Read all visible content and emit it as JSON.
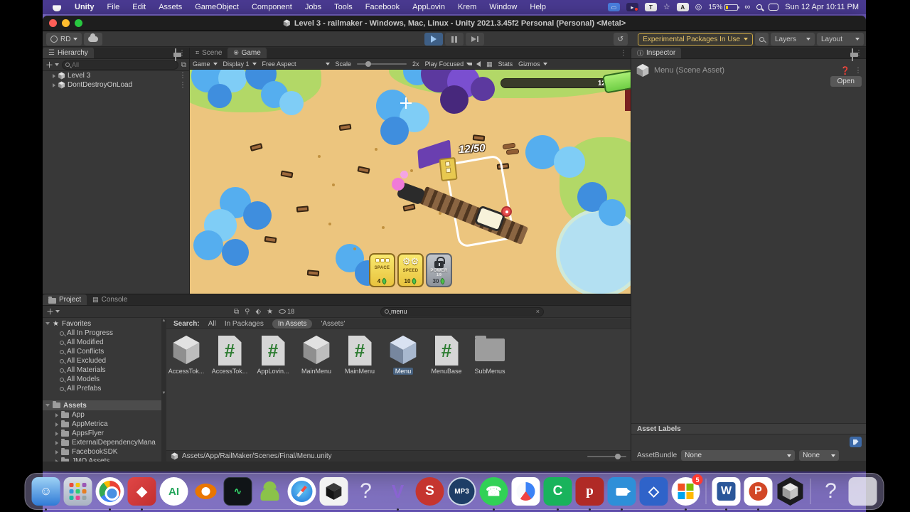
{
  "colors": {
    "accent_blue": "#4a7fe0",
    "experimental_gold": "#e3c168",
    "selection_blue": "#46607e",
    "play_active": "#3e5f86"
  },
  "menubar": {
    "items": [
      "Unity",
      "File",
      "Edit",
      "Assets",
      "GameObject",
      "Component",
      "Jobs",
      "Tools",
      "Facebook",
      "AppLovin",
      "Krem",
      "Window",
      "Help"
    ],
    "battery": "15%",
    "clock": "Sun 12 Apr 10:11 PM"
  },
  "window_title": "Level 3 - railmaker - Windows, Mac, Linux - Unity 2021.3.45f2 Personal (Personal) <Metal>",
  "toolbar": {
    "account": "RD",
    "experimental": "Experimental Packages In Use",
    "layers": "Layers",
    "layout": "Layout"
  },
  "hierarchy": {
    "tab": "Hierarchy",
    "search_placeholder": "All",
    "items": [
      "Level 3",
      "DontDestroyOnLoad"
    ]
  },
  "game": {
    "tab_scene": "Scene",
    "tab_game": "Game",
    "mode": "Game",
    "display": "Display 1",
    "aspect": "Free Aspect",
    "scale_label": "Scale",
    "scale_value": "2x",
    "focus": "Play Focused",
    "stats": "Stats",
    "gizmos": "Gizmos",
    "hud": {
      "progress_value": "12",
      "wood_counter": "12/50",
      "buttons": [
        {
          "label": "SPACE",
          "sub": "",
          "value": "4"
        },
        {
          "label": "SPEED",
          "sub": "",
          "value": "10"
        },
        {
          "label": "POWER",
          "sub": "1/9",
          "value": "30"
        }
      ]
    }
  },
  "inspector": {
    "tab": "Inspector",
    "title": "Menu (Scene Asset)",
    "open_button": "Open",
    "asset_labels_header": "Asset Labels",
    "assetbundle_label": "AssetBundle",
    "bundle_value": "None",
    "variant_value": "None"
  },
  "project": {
    "tab_project": "Project",
    "tab_console": "Console",
    "search_value": "menu",
    "eye_count": "18",
    "filter_label": "Search:",
    "filters": [
      "All",
      "In Packages",
      "In Assets",
      "'Assets'"
    ],
    "favorites_header": "Favorites",
    "favorites": [
      "All In Progress",
      "All Modified",
      "All Conflicts",
      "All Excluded",
      "All Materials",
      "All Models",
      "All Prefabs"
    ],
    "assets_header": "Assets",
    "folders": [
      "App",
      "AppMetrica",
      "AppsFlyer",
      "ExternalDependencyMana",
      "FacebookSDK",
      "JMO Assets"
    ],
    "grid": [
      {
        "name": "AccessTok...",
        "type": "asset"
      },
      {
        "name": "AccessTok...",
        "type": "script"
      },
      {
        "name": "AppLovin...",
        "type": "script"
      },
      {
        "name": "MainMenu",
        "type": "asset"
      },
      {
        "name": "MainMenu",
        "type": "script"
      },
      {
        "name": "Menu",
        "type": "asset-selected"
      },
      {
        "name": "MenuBase",
        "type": "script"
      },
      {
        "name": "SubMenus",
        "type": "folder"
      }
    ],
    "footer_path": "Assets/App/RailMaker/Scenes/Final/Menu.unity"
  },
  "dock": {
    "items": [
      {
        "name": "finder",
        "glyph": "☺"
      },
      {
        "name": "launchpad",
        "glyph": ""
      },
      {
        "name": "chrome",
        "glyph": ""
      },
      {
        "name": "appcode",
        "glyph": "◆"
      },
      {
        "name": "android-studio",
        "glyph": "AI"
      },
      {
        "name": "blender",
        "glyph": ""
      },
      {
        "name": "activity-monitor",
        "glyph": "∿"
      },
      {
        "name": "android",
        "glyph": ""
      },
      {
        "name": "safari",
        "glyph": ""
      },
      {
        "name": "unity-hub",
        "glyph": ""
      },
      {
        "name": "placeholder-question",
        "glyph": "?"
      },
      {
        "name": "visual-studio",
        "glyph": "V"
      },
      {
        "name": "rider",
        "glyph": "S"
      },
      {
        "name": "mp3-player",
        "glyph": "MP3"
      },
      {
        "name": "whatsapp",
        "glyph": "☎"
      },
      {
        "name": "paint-app",
        "glyph": ""
      },
      {
        "name": "camtasia",
        "glyph": "C"
      },
      {
        "name": "pandora",
        "glyph": "p"
      },
      {
        "name": "screen-recorder",
        "glyph": ""
      },
      {
        "name": "diamond-app",
        "glyph": "◇"
      },
      {
        "name": "ms365",
        "glyph": "",
        "badge": "5"
      },
      {
        "name": "word",
        "glyph": "W"
      },
      {
        "name": "powerpoint",
        "glyph": "P"
      },
      {
        "name": "unity-editor",
        "glyph": ""
      },
      {
        "name": "placeholder-question-2",
        "glyph": "?"
      },
      {
        "name": "trash",
        "glyph": ""
      }
    ]
  }
}
